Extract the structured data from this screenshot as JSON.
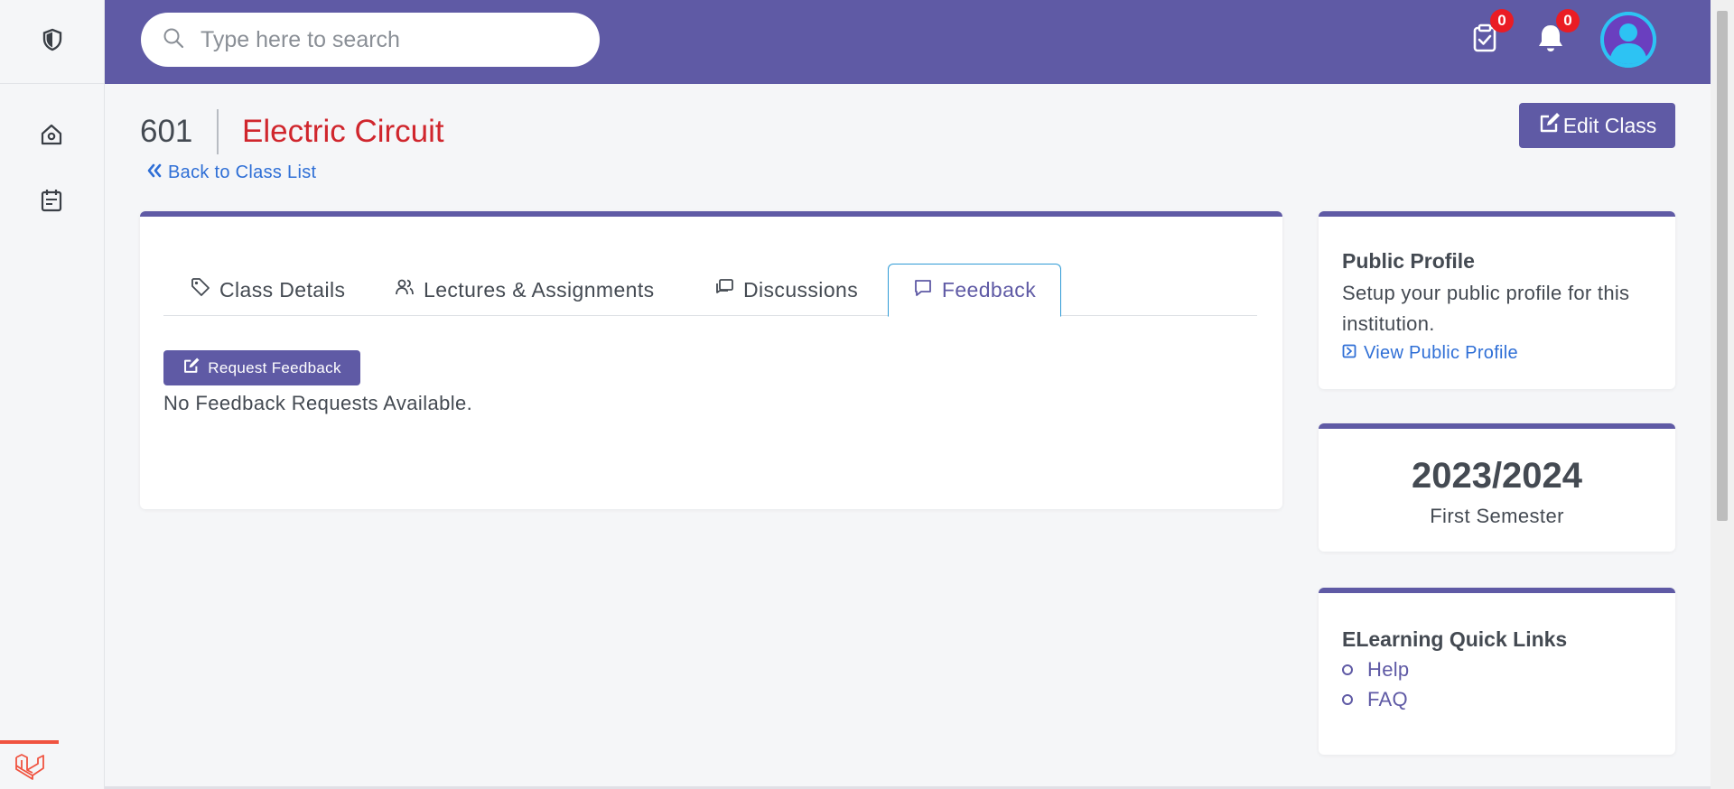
{
  "header": {
    "search_placeholder": "Type here to search",
    "tasks_count": "0",
    "notifications_count": "0"
  },
  "class": {
    "code": "601",
    "name": "Electric Circuit",
    "back_label": "Back to Class List",
    "edit_label": "Edit Class"
  },
  "tabs": [
    {
      "label": "Class Details",
      "icon": "tag-icon"
    },
    {
      "label": "Lectures & Assignments",
      "icon": "users-icon"
    },
    {
      "label": "Discussions",
      "icon": "chat-copy-icon"
    },
    {
      "label": "Feedback",
      "icon": "comment-icon",
      "active": true
    }
  ],
  "feedback": {
    "request_label": "Request Feedback",
    "empty_message": "No Feedback Requests Available."
  },
  "public_profile": {
    "title": "Public Profile",
    "description": "Setup your public profile for this institution.",
    "link_label": "View Public Profile"
  },
  "semester": {
    "year": "2023/2024",
    "name": "First Semester"
  },
  "quick_links": {
    "title": "ELearning Quick Links",
    "items": [
      "Help",
      "FAQ"
    ]
  },
  "colors": {
    "brand": "#5f5aa5",
    "title_red": "#d0262d",
    "link_blue": "#2f6fd6",
    "badge_red": "#ea1c24"
  }
}
